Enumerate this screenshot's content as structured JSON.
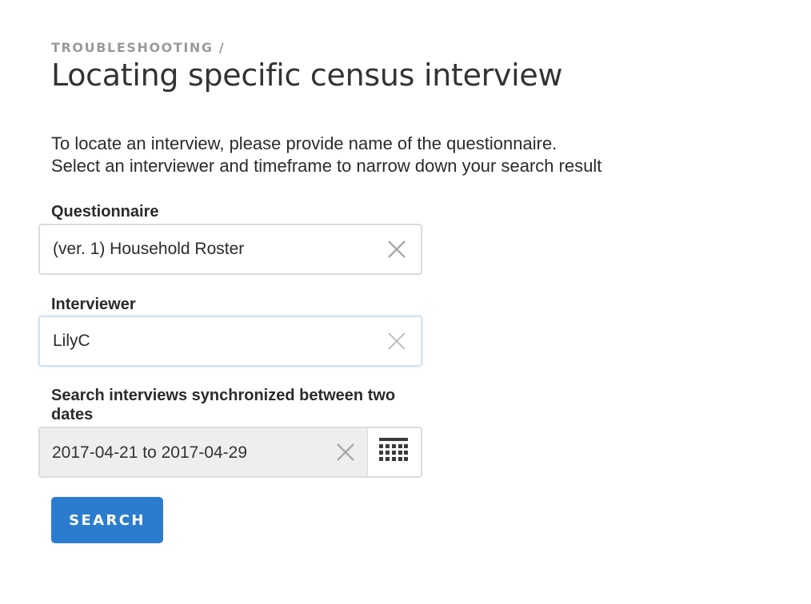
{
  "header": {
    "breadcrumb": "TROUBLESHOOTING /",
    "title": "Locating specific census interview"
  },
  "intro": {
    "line1": "To locate an interview, please provide name of the questionnaire.",
    "line2": "Select an interviewer and timeframe to narrow down your search result"
  },
  "form": {
    "questionnaire": {
      "label": "Questionnaire",
      "value": "(ver. 1) Household Roster",
      "clear_icon": "close-icon"
    },
    "interviewer": {
      "label": "Interviewer",
      "value": "LilyC",
      "clear_icon": "close-icon"
    },
    "date_range": {
      "label": "Search interviews synchronized between two dates",
      "value": "2017-04-21 to 2017-04-29",
      "clear_icon": "close-icon",
      "picker_icon": "calendar-icon"
    },
    "search_label": "SEARCH"
  },
  "colors": {
    "accent": "#2b7ccf",
    "breadcrumb": "#9a9a9a",
    "border": "#dcdcdc",
    "disabled_bg": "#eeeeee"
  }
}
